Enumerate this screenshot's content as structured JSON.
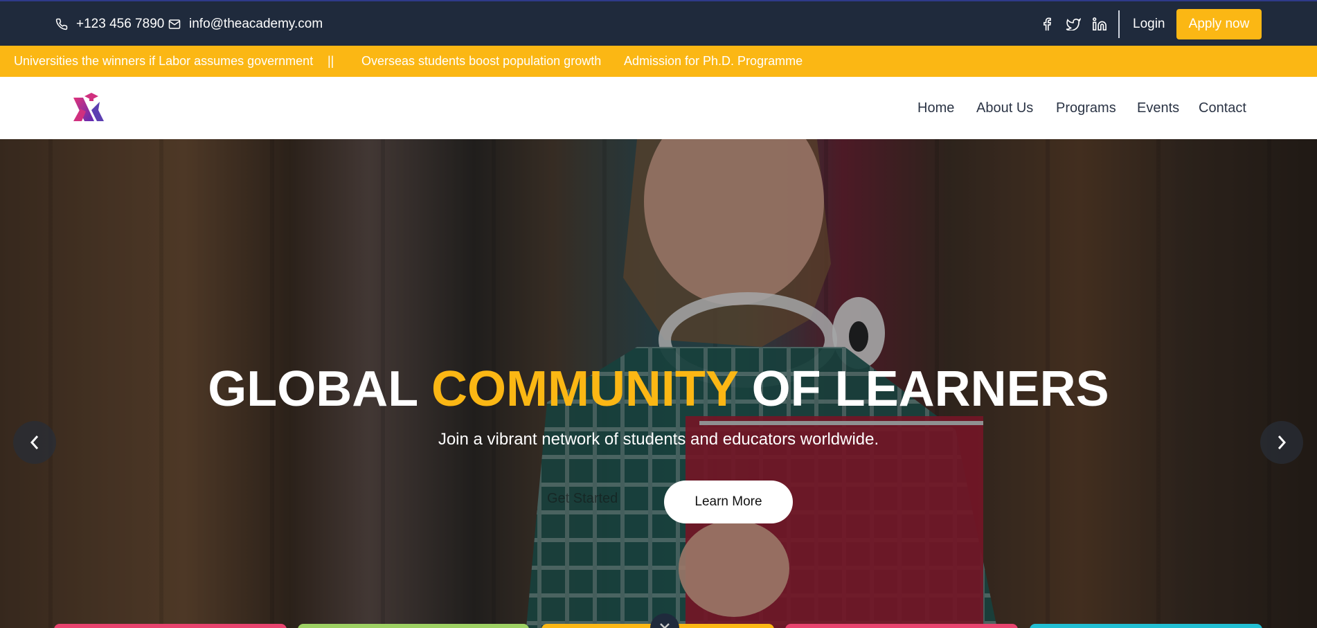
{
  "topbar": {
    "phone": "+123 456 7890",
    "email": "info@theacademy.com",
    "social": [
      "facebook-icon",
      "twitter-icon",
      "linkedin-icon"
    ],
    "login_label": "Login",
    "apply_label": "Apply now"
  },
  "ticker": {
    "items": [
      "Universities the winners if Labor assumes government",
      "||",
      "Overseas students boost population growth",
      "Admission for Ph.D. Programme"
    ]
  },
  "nav": {
    "items": [
      "Home",
      "About Us",
      "Programs",
      "Events",
      "Contact"
    ]
  },
  "hero": {
    "title_part1": "GLOBAL",
    "title_highlight": "COMMUNITY",
    "title_part2": "OF LEARNERS",
    "subtitle": "Join a vibrant network of students and educators worldwide.",
    "ghost_button": "Get Started",
    "button": "Learn More"
  },
  "colors": {
    "topbar_bg": "#1f2a3c",
    "accent": "#fbb714",
    "nav_text": "#2b3445",
    "card_colors": [
      "#e8436e",
      "#9dd163",
      "#fbb714",
      "#e8436e",
      "#22bfd3"
    ]
  }
}
